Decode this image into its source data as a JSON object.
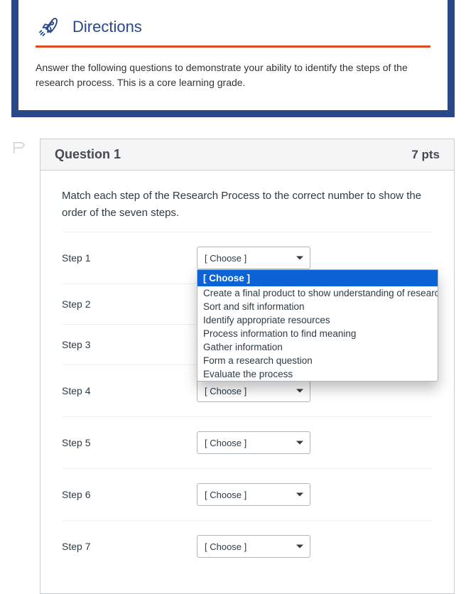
{
  "directions": {
    "title": "Directions",
    "body": "Answer the following questions to demonstrate your ability to identify the steps of the research process. This is a core learning grade."
  },
  "question": {
    "title": "Question 1",
    "points": "7 pts",
    "prompt": "Match each step of the Research Process to the correct number to show the order of the seven steps.",
    "choose_placeholder": "[ Choose ]",
    "steps": {
      "s1": "Step 1",
      "s2": "Step 2",
      "s3": "Step 3",
      "s4": "Step 4",
      "s5": "Step 5",
      "s6": "Step 6",
      "s7": "Step 7"
    }
  },
  "dropdown": {
    "selected": "[ Choose ]",
    "opt1": "Create a final product to show understanding of research",
    "opt2": "Sort and sift information",
    "opt3": "Identify appropriate resources",
    "opt4": "Process information to find meaning",
    "opt5": "Gather information",
    "opt6": "Form a research question",
    "opt7": "Evaluate the process"
  }
}
